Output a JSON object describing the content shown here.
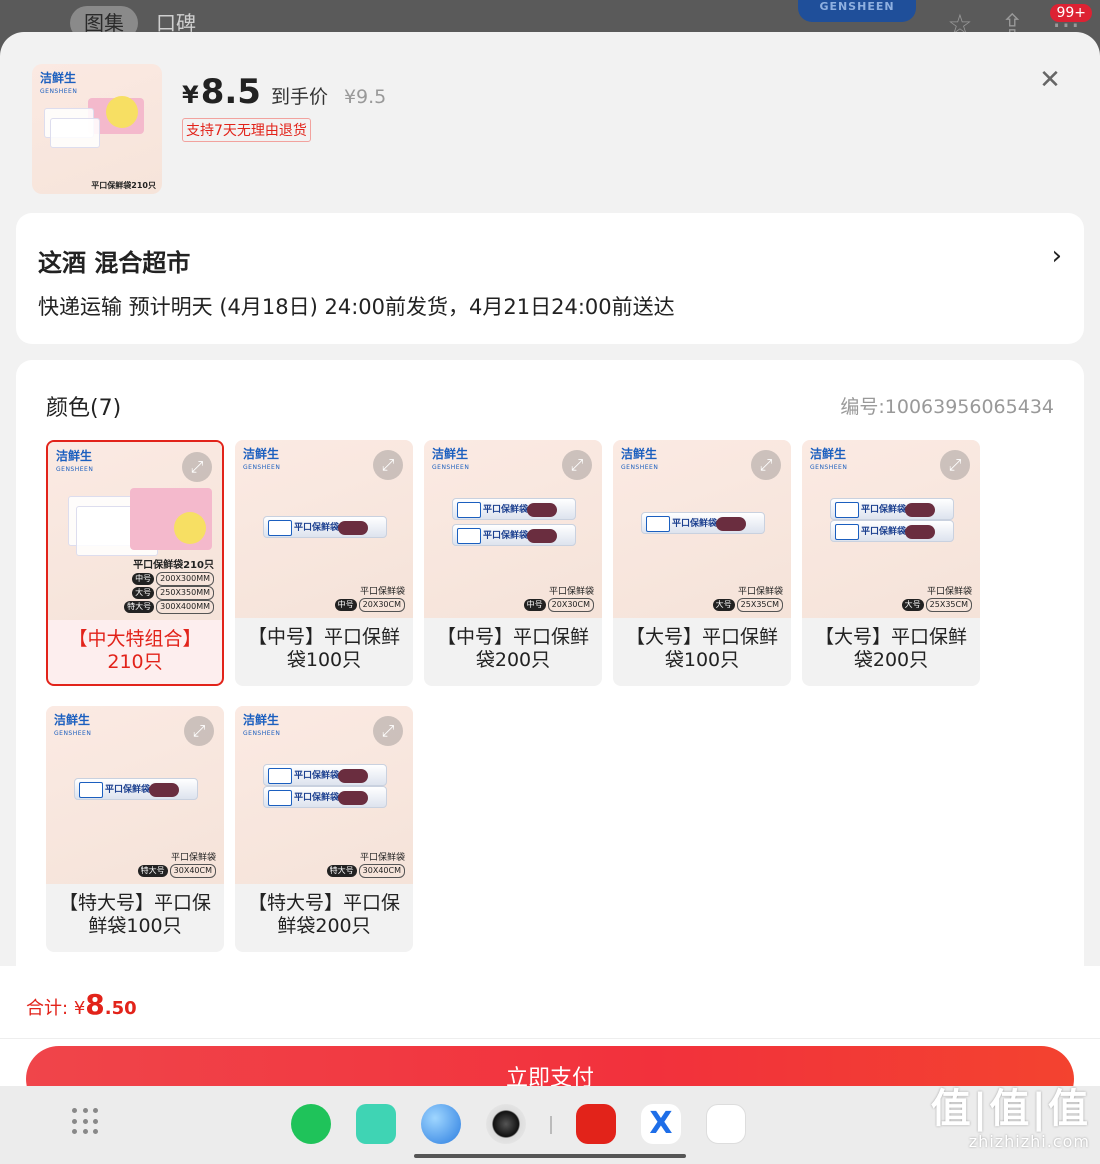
{
  "background": {
    "tabs": [
      "图集",
      "口碑"
    ],
    "logo": "GENSHEEN",
    "badge": "99+"
  },
  "product": {
    "currency": "¥",
    "price": "8.5",
    "price_tag": "到手价",
    "original_price": "¥9.5",
    "return_policy": "支持7天无理由退货",
    "thumb_title": "平口保鲜袋210只"
  },
  "shipping": {
    "store": "这酒  混合超市",
    "info": "快递运输 预计明天 (4月18日) 24:00前发货，4月21日24:00前送达"
  },
  "spec": {
    "label": "颜色(7)",
    "code": "编号:10063956065434",
    "brand": "洁鲜生",
    "brand_en": "GENSHEEN",
    "item_caption": "平口保鲜袋",
    "options": [
      {
        "name": "【中大特组合】210只",
        "selected": true,
        "type": "combo",
        "size_tag": "",
        "size_val": ""
      },
      {
        "name": "【中号】平口保鲜袋100只",
        "selected": false,
        "type": "roll1",
        "size_tag": "中号",
        "size_val": "20X30CM"
      },
      {
        "name": "【中号】平口保鲜袋200只",
        "selected": false,
        "type": "roll2",
        "size_tag": "中号",
        "size_val": "20X30CM"
      },
      {
        "name": "【大号】平口保鲜袋100只",
        "selected": false,
        "type": "roll1",
        "size_tag": "大号",
        "size_val": "25X35CM"
      },
      {
        "name": "【大号】平口保鲜袋200只",
        "selected": false,
        "type": "roll2",
        "size_tag": "大号",
        "size_val": "25X35CM"
      },
      {
        "name": "【特大号】平口保鲜袋100只",
        "selected": false,
        "type": "roll1",
        "size_tag": "特大号",
        "size_val": "30X40CM"
      },
      {
        "name": "【特大号】平口保鲜袋200只",
        "selected": false,
        "type": "roll2",
        "size_tag": "特大号",
        "size_val": "30X40CM"
      }
    ],
    "combo_sizes": [
      {
        "tag": "中号",
        "val": "200X300MM"
      },
      {
        "tag": "大号",
        "val": "250X350MM"
      },
      {
        "tag": "特大号",
        "val": "300X400MM"
      }
    ]
  },
  "footer": {
    "total_label": "合计:",
    "currency": "¥",
    "total_int": "8",
    "total_dec": ".50",
    "pay_label": "立即支付"
  },
  "watermark": {
    "line1": "值|值|值",
    "line2": "zhizhizhi.com"
  },
  "colors": {
    "accent": "#e2231a",
    "pay_button": "#f2313c"
  }
}
